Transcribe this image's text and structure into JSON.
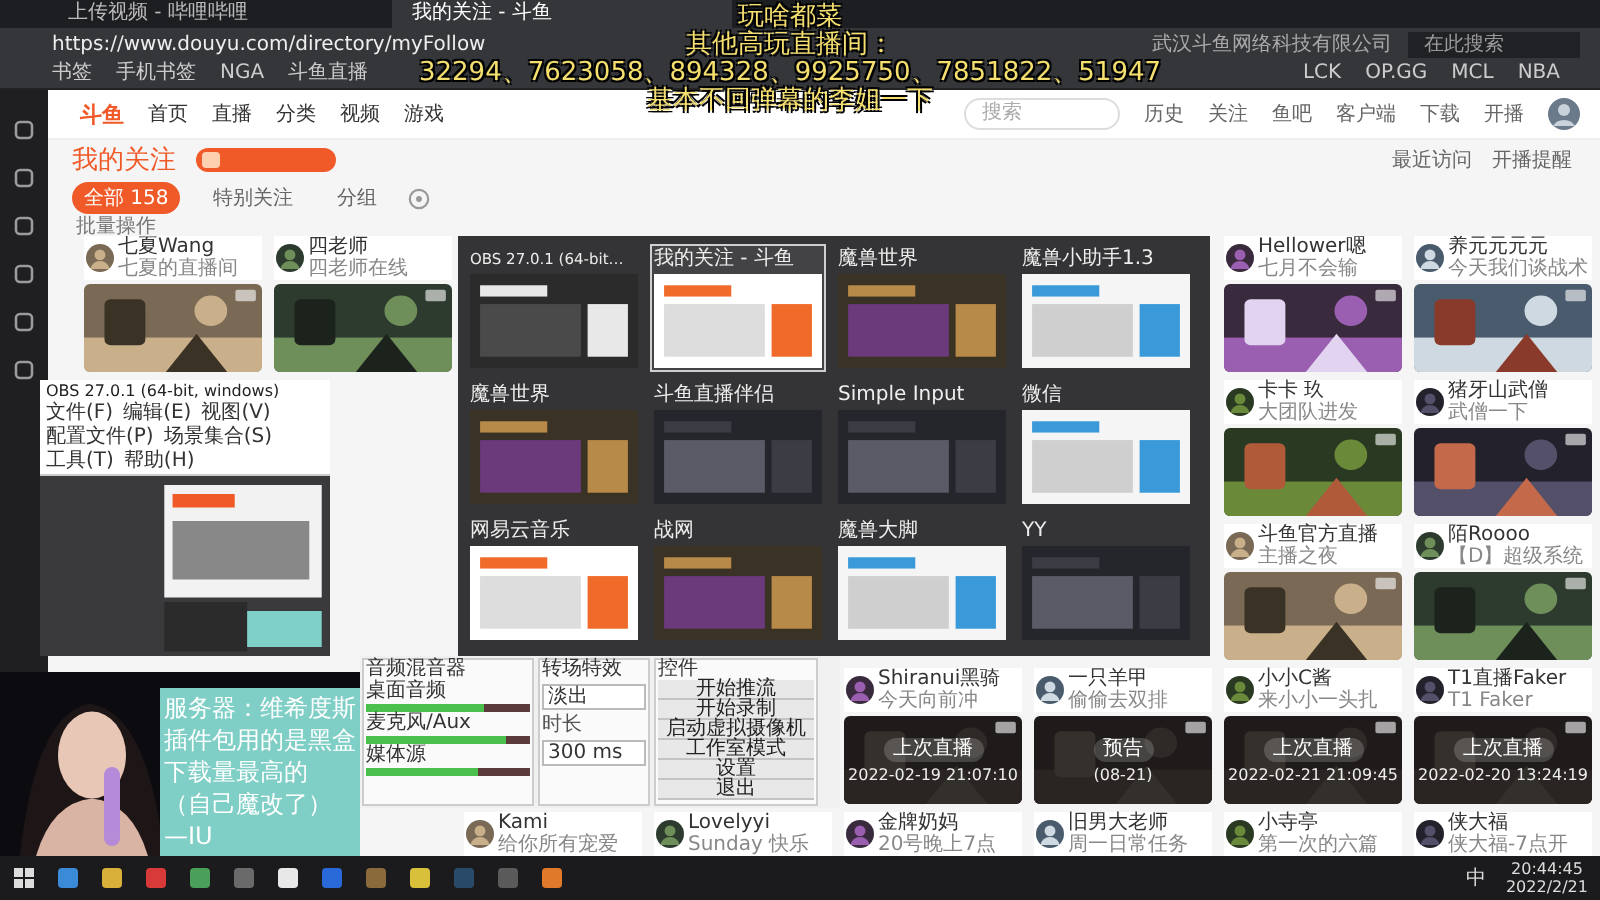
{
  "browser": {
    "tabs": [
      {
        "title": "上传视频 - 哔哩哔哩",
        "selected": false
      },
      {
        "title": "我的关注 - 斗鱼",
        "selected": true
      }
    ],
    "site_identity": "武汉斗鱼网络科技有限公司",
    "url": "https://www.douyu.com/directory/myFollow",
    "search_placeholder": "在此搜索",
    "bookmarks": [
      "书签",
      "手机书签",
      "NGA",
      "斗鱼直播",
      "LCK",
      "OP.GG",
      "MCL",
      "NBA"
    ]
  },
  "site": {
    "logo": "斗鱼",
    "nav": [
      "首页",
      "直播",
      "分类",
      "视频",
      "游戏"
    ],
    "search_placeholder": "搜索",
    "header_links": [
      "历史",
      "关注",
      "鱼吧",
      "客户端",
      "下载",
      "开播"
    ]
  },
  "follow": {
    "title": "我的关注",
    "filters": [
      {
        "label": "全部 158",
        "selected": true
      },
      {
        "label": "特别关注",
        "selected": false
      },
      {
        "label": "分组",
        "selected": false
      }
    ],
    "links": [
      "最近访问",
      "开播提醒"
    ],
    "batch": "批量操作"
  },
  "cards": [
    {
      "name": "七夏Wang",
      "desc": "七夏的直播间"
    },
    {
      "name": "四老师",
      "desc": "四老师在线"
    },
    {
      "name": "Hellower嗯",
      "desc": "七月不会输"
    },
    {
      "name": "养元元元元",
      "desc": "今天我们谈战术"
    },
    {
      "name": "卡卡 玖",
      "desc": "大团队进发"
    },
    {
      "name": "猪牙山武僧",
      "desc": "武僧一下"
    },
    {
      "name": "斗鱼官方直播",
      "desc": "主播之夜"
    },
    {
      "name": "陌Roooo",
      "desc": "【D】超级系统"
    },
    {
      "name": "Shiranui黑骑",
      "desc": "今天向前冲",
      "thumb": {
        "kind": "picture",
        "status": "上次直播",
        "time": "2022-02-19 21:07:10"
      }
    },
    {
      "name": "一只羊甲",
      "desc": "偷偷去双排",
      "thumb": {
        "kind": "picture",
        "status": "预告",
        "time": "(08-21)"
      }
    },
    {
      "name": "小小C酱",
      "desc": "来小小一头扎",
      "thumb": {
        "kind": "picture",
        "status": "上次直播",
        "time": "2022-02-21 21:09:45"
      }
    },
    {
      "name": "T1直播Faker",
      "desc": "T1 Faker",
      "thumb": {
        "kind": "picture",
        "status": "上次直播",
        "time": "2022-02-20 13:24:19"
      }
    },
    {
      "name": "Kami",
      "desc": "给你所有宠爱"
    },
    {
      "name": "Lovelyyi",
      "desc": "Sunday 快乐"
    },
    {
      "name": "金牌奶妈",
      "desc": "20号晚上7点"
    },
    {
      "name": "旧男大老师",
      "desc": "周一日常任务"
    },
    {
      "name": "小寺亭",
      "desc": "第一次的六篇"
    },
    {
      "name": "侠大福",
      "desc": "侠大福-7点开"
    }
  ],
  "switcher": {
    "windows": [
      {
        "title": "OBS 27.0.1 (64-bit…",
        "kind": "obs",
        "selected": false
      },
      {
        "title": "我的关注 - 斗鱼",
        "kind": "browser",
        "selected": true
      },
      {
        "title": "魔兽世界",
        "kind": "game",
        "selected": false
      },
      {
        "title": "魔兽小助手1.3",
        "kind": "tool",
        "selected": false
      },
      {
        "title": "魔兽世界",
        "kind": "game",
        "selected": false
      },
      {
        "title": "斗鱼直播伴侣",
        "kind": "dark",
        "selected": false
      },
      {
        "title": "Simple Input",
        "kind": "dark",
        "selected": false
      },
      {
        "title": "微信",
        "kind": "tool",
        "selected": false
      },
      {
        "title": "网易云音乐",
        "kind": "browser",
        "selected": false
      },
      {
        "title": "战网",
        "kind": "game",
        "selected": false
      },
      {
        "title": "魔兽大脚",
        "kind": "tool",
        "selected": false
      },
      {
        "title": "YY",
        "kind": "dark",
        "selected": false
      }
    ]
  },
  "obs_window": {
    "title": "OBS 27.0.1 (64-bit, windows)",
    "menu": [
      "文件(F)",
      "编辑(E)",
      "视图(V)",
      "配置文件(P)",
      "场景集合(S)",
      "工具(T)",
      "帮助(H)"
    ]
  },
  "obs_dock": {
    "mixer_title": "音频混音器",
    "channels": [
      {
        "name": "桌面音频",
        "level": 0.72
      },
      {
        "name": "麦克风/Aux",
        "level": 0.85
      },
      {
        "name": "媒体源",
        "level": 0.68
      }
    ],
    "transition_title": "转场特效",
    "transition": "淡出",
    "duration_label": "时长",
    "duration": "300 ms",
    "controls_title": "控件",
    "controls": [
      "开始推流",
      "开始录制",
      "启动虚拟摄像机",
      "工作室模式",
      "设置",
      "退出"
    ]
  },
  "overlay": {
    "lines": [
      "玩啥都菜",
      "其他高玩直播间：",
      "32294、7623058、894328、9925750、7851822、51947",
      "基本不回弹幕的李姐一下"
    ]
  },
  "webcam": {
    "kind": "picture",
    "caption_lines": [
      "服务器：维希度斯",
      "插件包用的是黑盒",
      "下载量最高的",
      "（自己魔改了）",
      "—IU"
    ]
  },
  "taskbar": {
    "ime": "中",
    "time": "20:44:45",
    "date": "2022/2/21"
  }
}
